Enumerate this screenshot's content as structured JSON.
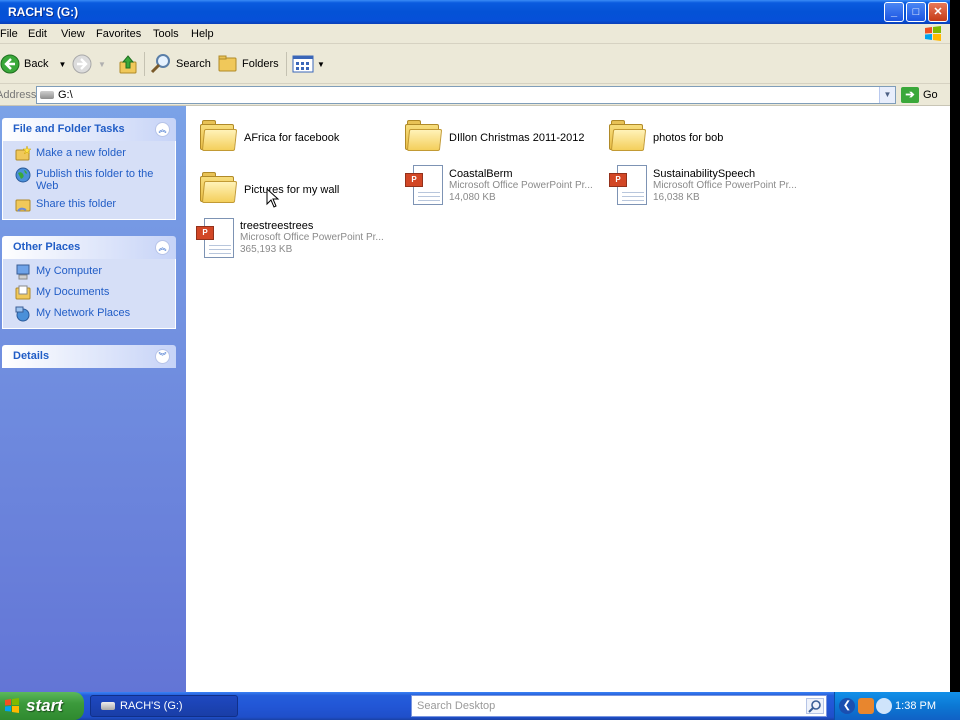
{
  "window": {
    "title": "RACH'S (G:)",
    "buttons": {
      "minimize": "_",
      "maximize": "□",
      "close": "✕"
    }
  },
  "menu": [
    "File",
    "Edit",
    "View",
    "Favorites",
    "Tools",
    "Help"
  ],
  "toolbar": {
    "back_label": "Back",
    "search_label": "Search",
    "folders_label": "Folders"
  },
  "address": {
    "label": "Address",
    "value": "G:\\",
    "go_label": "Go"
  },
  "sidebar": {
    "tasks": {
      "title": "File and Folder Tasks",
      "items": [
        {
          "label": "Make a new folder",
          "icon": "new-folder-icon"
        },
        {
          "label": "Publish this folder to the Web",
          "icon": "globe-icon"
        },
        {
          "label": "Share this folder",
          "icon": "share-folder-icon"
        }
      ]
    },
    "places": {
      "title": "Other Places",
      "items": [
        {
          "label": "My Computer",
          "icon": "computer-icon"
        },
        {
          "label": "My Documents",
          "icon": "documents-icon"
        },
        {
          "label": "My Network Places",
          "icon": "network-icon"
        }
      ]
    },
    "details": {
      "title": "Details"
    }
  },
  "files": [
    {
      "name": "AFrica for facebook",
      "type": "folder"
    },
    {
      "name": "DIllon Christmas 2011-2012",
      "type": "folder"
    },
    {
      "name": "photos for bob",
      "type": "folder"
    },
    {
      "name": "Pictures for my wall",
      "type": "folder"
    },
    {
      "name": "CoastalBerm",
      "type": "ppt",
      "kind": "Microsoft Office PowerPoint Pr...",
      "size": "14,080 KB"
    },
    {
      "name": "SustainabilitySpeech",
      "type": "ppt",
      "kind": "Microsoft Office PowerPoint Pr...",
      "size": "16,038 KB"
    },
    {
      "name": "treestreestrees",
      "type": "ppt",
      "kind": "Microsoft Office PowerPoint Pr...",
      "size": "365,193 KB"
    }
  ],
  "taskbar": {
    "start_label": "start",
    "task_label": "RACH'S (G:)",
    "search_placeholder": "Search Desktop",
    "clock": "1:38 PM"
  },
  "colors": {
    "title_blue": "#0452d6",
    "sidebar_link": "#215dc6",
    "start_green": "#3c9a3c"
  }
}
